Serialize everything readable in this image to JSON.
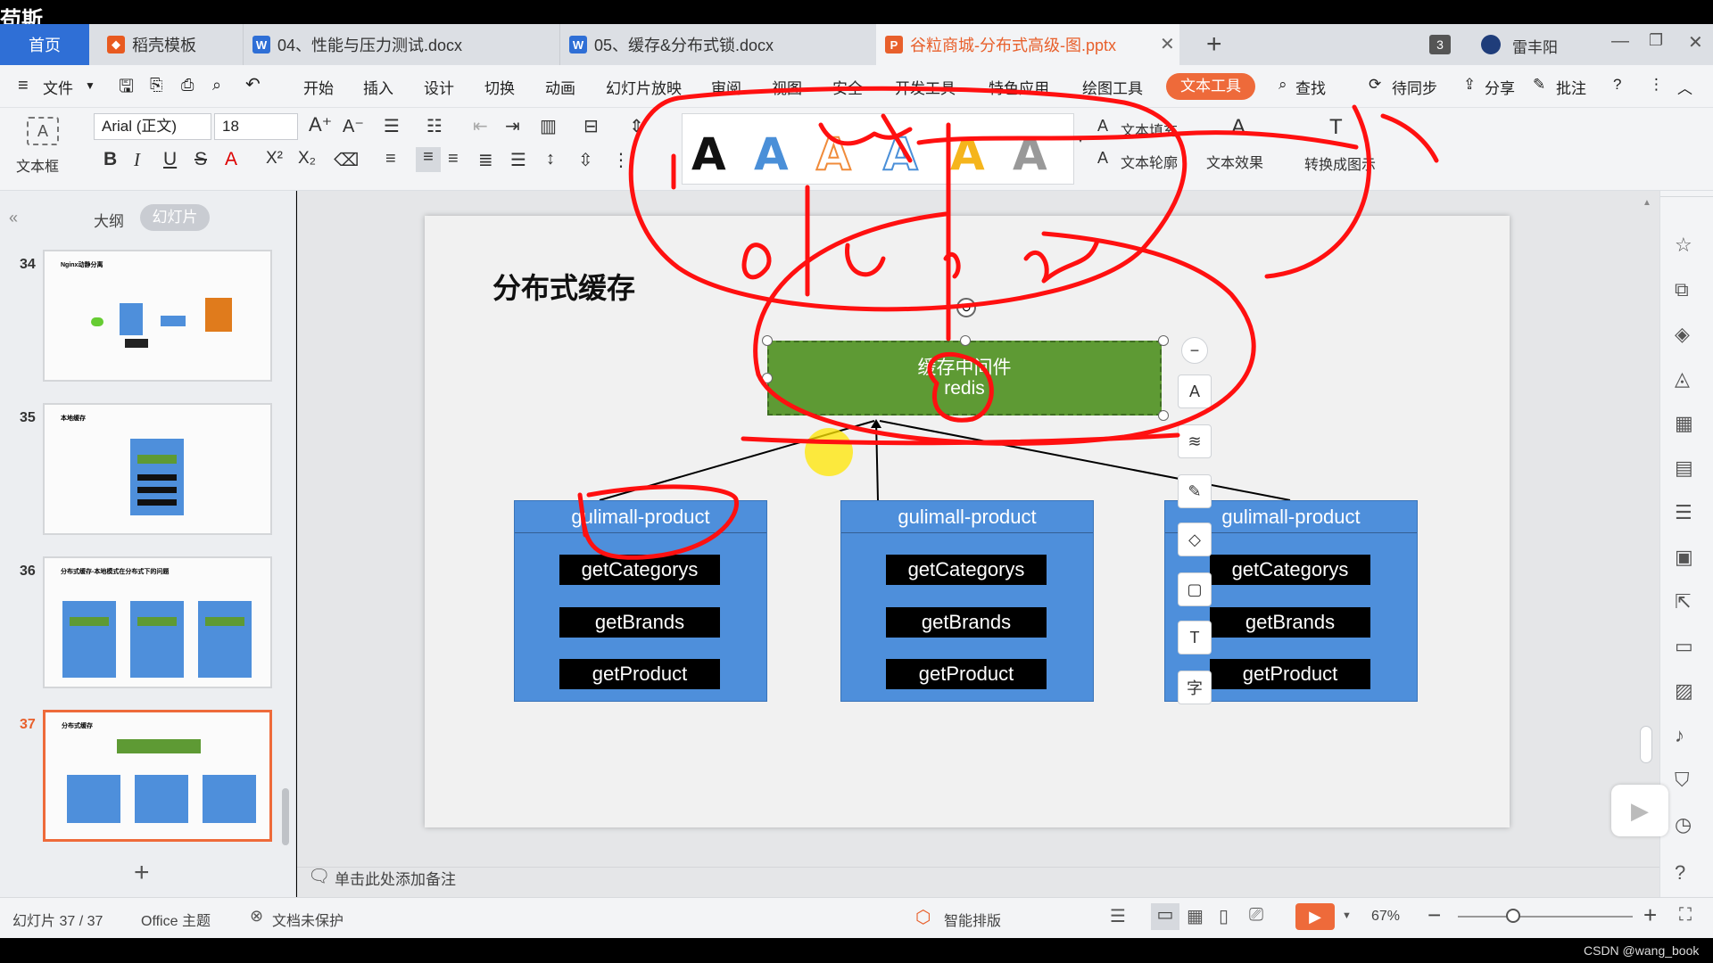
{
  "tabs": {
    "home": "首页",
    "template": "稻壳模板",
    "doc1": "04、性能与压力测试.docx",
    "doc2": "05、缓存&分布式锁.docx",
    "ppt": "谷粒商城-分布式高级-图.pptx",
    "badge": "3",
    "user": "雷丰阳"
  },
  "menu": {
    "file": "文件",
    "items": [
      "开始",
      "插入",
      "设计",
      "切换",
      "动画",
      "幻灯片放映",
      "审阅",
      "视图",
      "安全",
      "开发工具",
      "特色应用",
      "绘图工具",
      "文本工具"
    ],
    "search": "查找",
    "sync": "待同步",
    "share": "分享",
    "comment": "批注"
  },
  "ribbon": {
    "textbox_label": "文本框",
    "font_name": "Arial (正文)",
    "font_size": "18",
    "text_fill": "文本填充",
    "text_outline": "文本轮廓",
    "text_effect": "文本效果",
    "convert_label": "转换成图示"
  },
  "left_panel": {
    "tab_outline": "大纲",
    "tab_slides": "幻灯片",
    "slides": [
      {
        "num": "34",
        "title": "Nginx动静分离"
      },
      {
        "num": "35",
        "title": "本地缓存"
      },
      {
        "num": "36",
        "title": "分布式缓存-本地模式在分布式下的问题"
      },
      {
        "num": "37",
        "title": "分布式缓存"
      }
    ]
  },
  "slide": {
    "title": "分布式缓存",
    "cache_line1": "缓存中间件",
    "cache_line2": "redis",
    "services": [
      {
        "name": "gulimall-product",
        "methods": [
          "getCategorys",
          "getBrands",
          "getProduct"
        ]
      },
      {
        "name": "gulimall-product",
        "methods": [
          "getCategorys",
          "getBrands",
          "getProduct"
        ]
      },
      {
        "name": "gulimall-product",
        "methods": [
          "getCategorys",
          "getBrands",
          "getProduct"
        ]
      }
    ]
  },
  "notes_placeholder": "单击此处添加备注",
  "status": {
    "slide_counter": "幻灯片 37 / 37",
    "theme": "Office 主题",
    "protect": "文档未保护",
    "smart_layout": "智能排版",
    "zoom": "67%"
  },
  "watermark": "CSDN @wang_book",
  "corner_text": "苟斯",
  "colors": {
    "accent_orange": "#ee6a3a",
    "cache_green": "#5e9a34",
    "service_blue": "#4e8fdb",
    "annotation_red": "#ff1010"
  }
}
